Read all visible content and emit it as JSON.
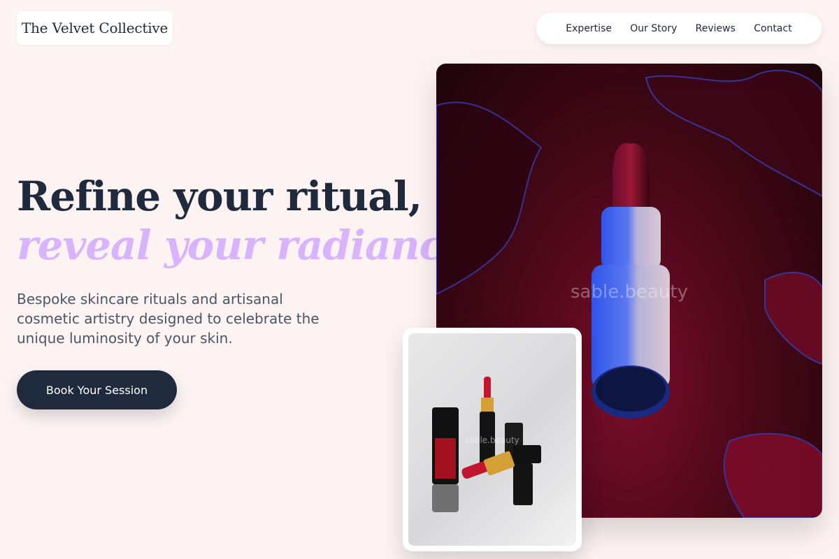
{
  "brand": {
    "name": "The Velvet Collective"
  },
  "nav": {
    "items": [
      {
        "label": "Expertise"
      },
      {
        "label": "Our Story"
      },
      {
        "label": "Reviews"
      },
      {
        "label": "Contact"
      }
    ]
  },
  "hero": {
    "headline_line1": "Refine your ritual,",
    "headline_line2": "reveal your radiance.",
    "subtext": "Bespoke skincare rituals and artisanal cosmetic artistry designed to celebrate the unique luminosity of your skin.",
    "cta_label": "Book Your Session"
  },
  "images": {
    "main_watermark": "sable.beauty",
    "inset_watermark": "sable.beauty"
  },
  "colors": {
    "background": "#fdf3f3",
    "primary": "#1f2a3d",
    "accent": "#d8b4fe"
  }
}
